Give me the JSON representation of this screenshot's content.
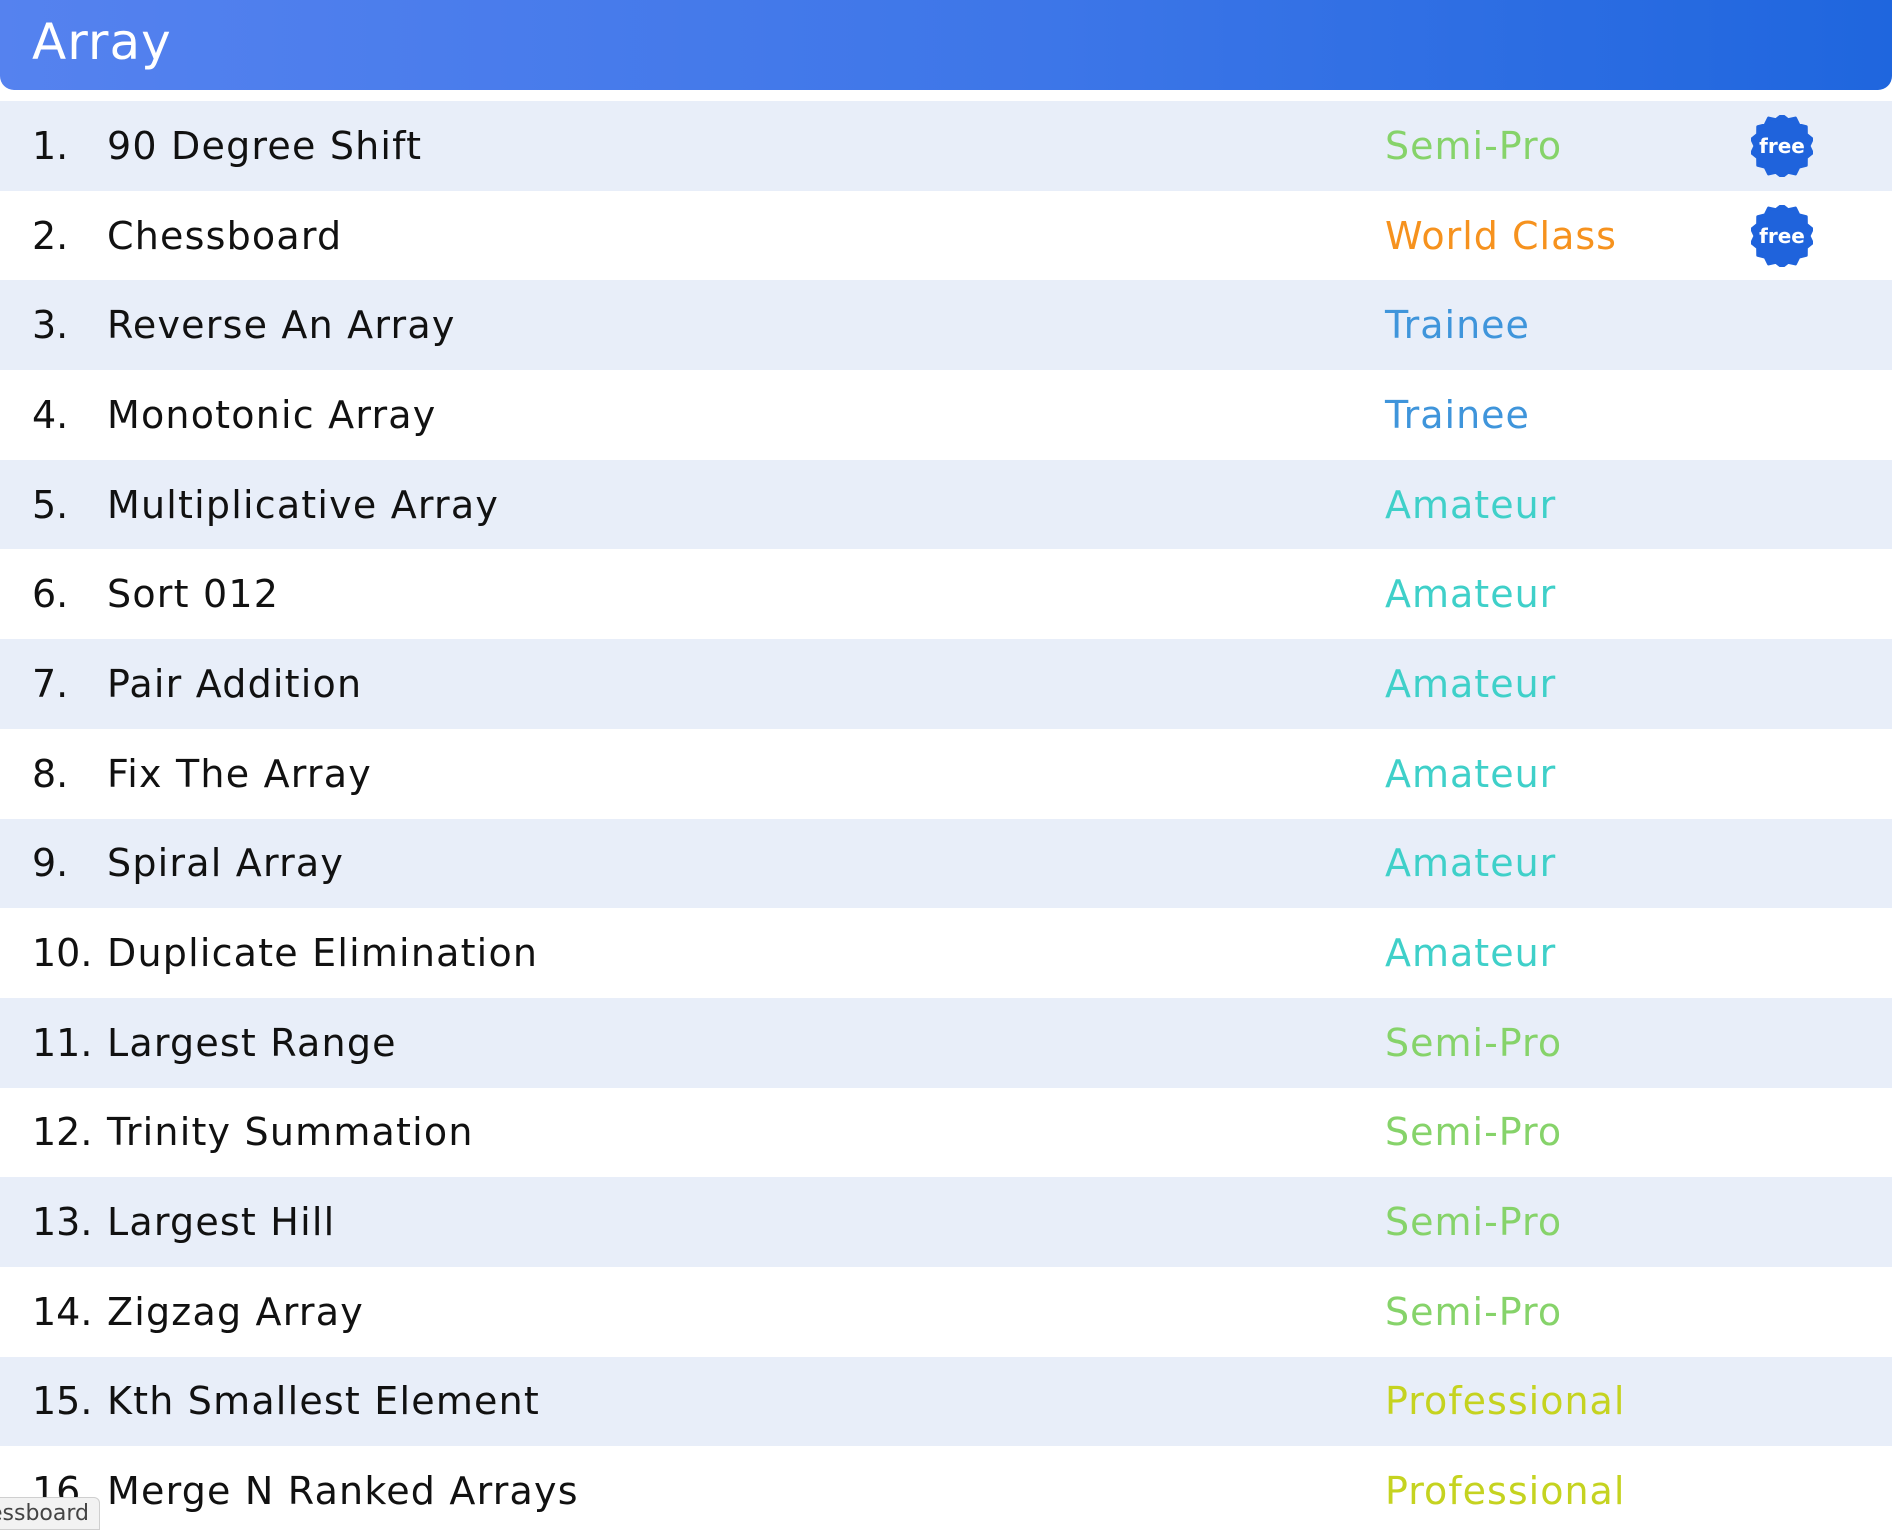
{
  "header": {
    "title": "Array"
  },
  "colors": {
    "Trainee": "#3f95db",
    "Amateur": "#3fd0c9",
    "Semi-Pro": "#86d36a",
    "Professional": "#c5d320",
    "World Class": "#f6921e",
    "badge": "#1f63dc"
  },
  "problems": [
    {
      "num": "1.",
      "title": "90 Degree Shift",
      "level": "Semi-Pro",
      "badge": "free"
    },
    {
      "num": "2.",
      "title": "Chessboard",
      "level": "World Class",
      "badge": "free"
    },
    {
      "num": "3.",
      "title": "Reverse An Array",
      "level": "Trainee",
      "badge": ""
    },
    {
      "num": "4.",
      "title": "Monotonic Array",
      "level": "Trainee",
      "badge": ""
    },
    {
      "num": "5.",
      "title": "Multiplicative Array",
      "level": "Amateur",
      "badge": ""
    },
    {
      "num": "6.",
      "title": "Sort 012",
      "level": "Amateur",
      "badge": ""
    },
    {
      "num": "7.",
      "title": "Pair Addition",
      "level": "Amateur",
      "badge": ""
    },
    {
      "num": "8.",
      "title": "Fix The Array",
      "level": "Amateur",
      "badge": ""
    },
    {
      "num": "9.",
      "title": "Spiral Array",
      "level": "Amateur",
      "badge": ""
    },
    {
      "num": "10.",
      "title": "Duplicate Elimination",
      "level": "Amateur",
      "badge": ""
    },
    {
      "num": "11.",
      "title": "Largest Range",
      "level": "Semi-Pro",
      "badge": ""
    },
    {
      "num": "12.",
      "title": "Trinity Summation",
      "level": "Semi-Pro",
      "badge": ""
    },
    {
      "num": "13.",
      "title": "Largest Hill",
      "level": "Semi-Pro",
      "badge": ""
    },
    {
      "num": "14.",
      "title": "Zigzag Array",
      "level": "Semi-Pro",
      "badge": ""
    },
    {
      "num": "15.",
      "title": "Kth Smallest Element",
      "level": "Professional",
      "badge": ""
    },
    {
      "num": "16.",
      "title": "Merge N Ranked Arrays",
      "level": "Professional",
      "badge": ""
    }
  ],
  "tooltip": {
    "text": "essboard"
  }
}
